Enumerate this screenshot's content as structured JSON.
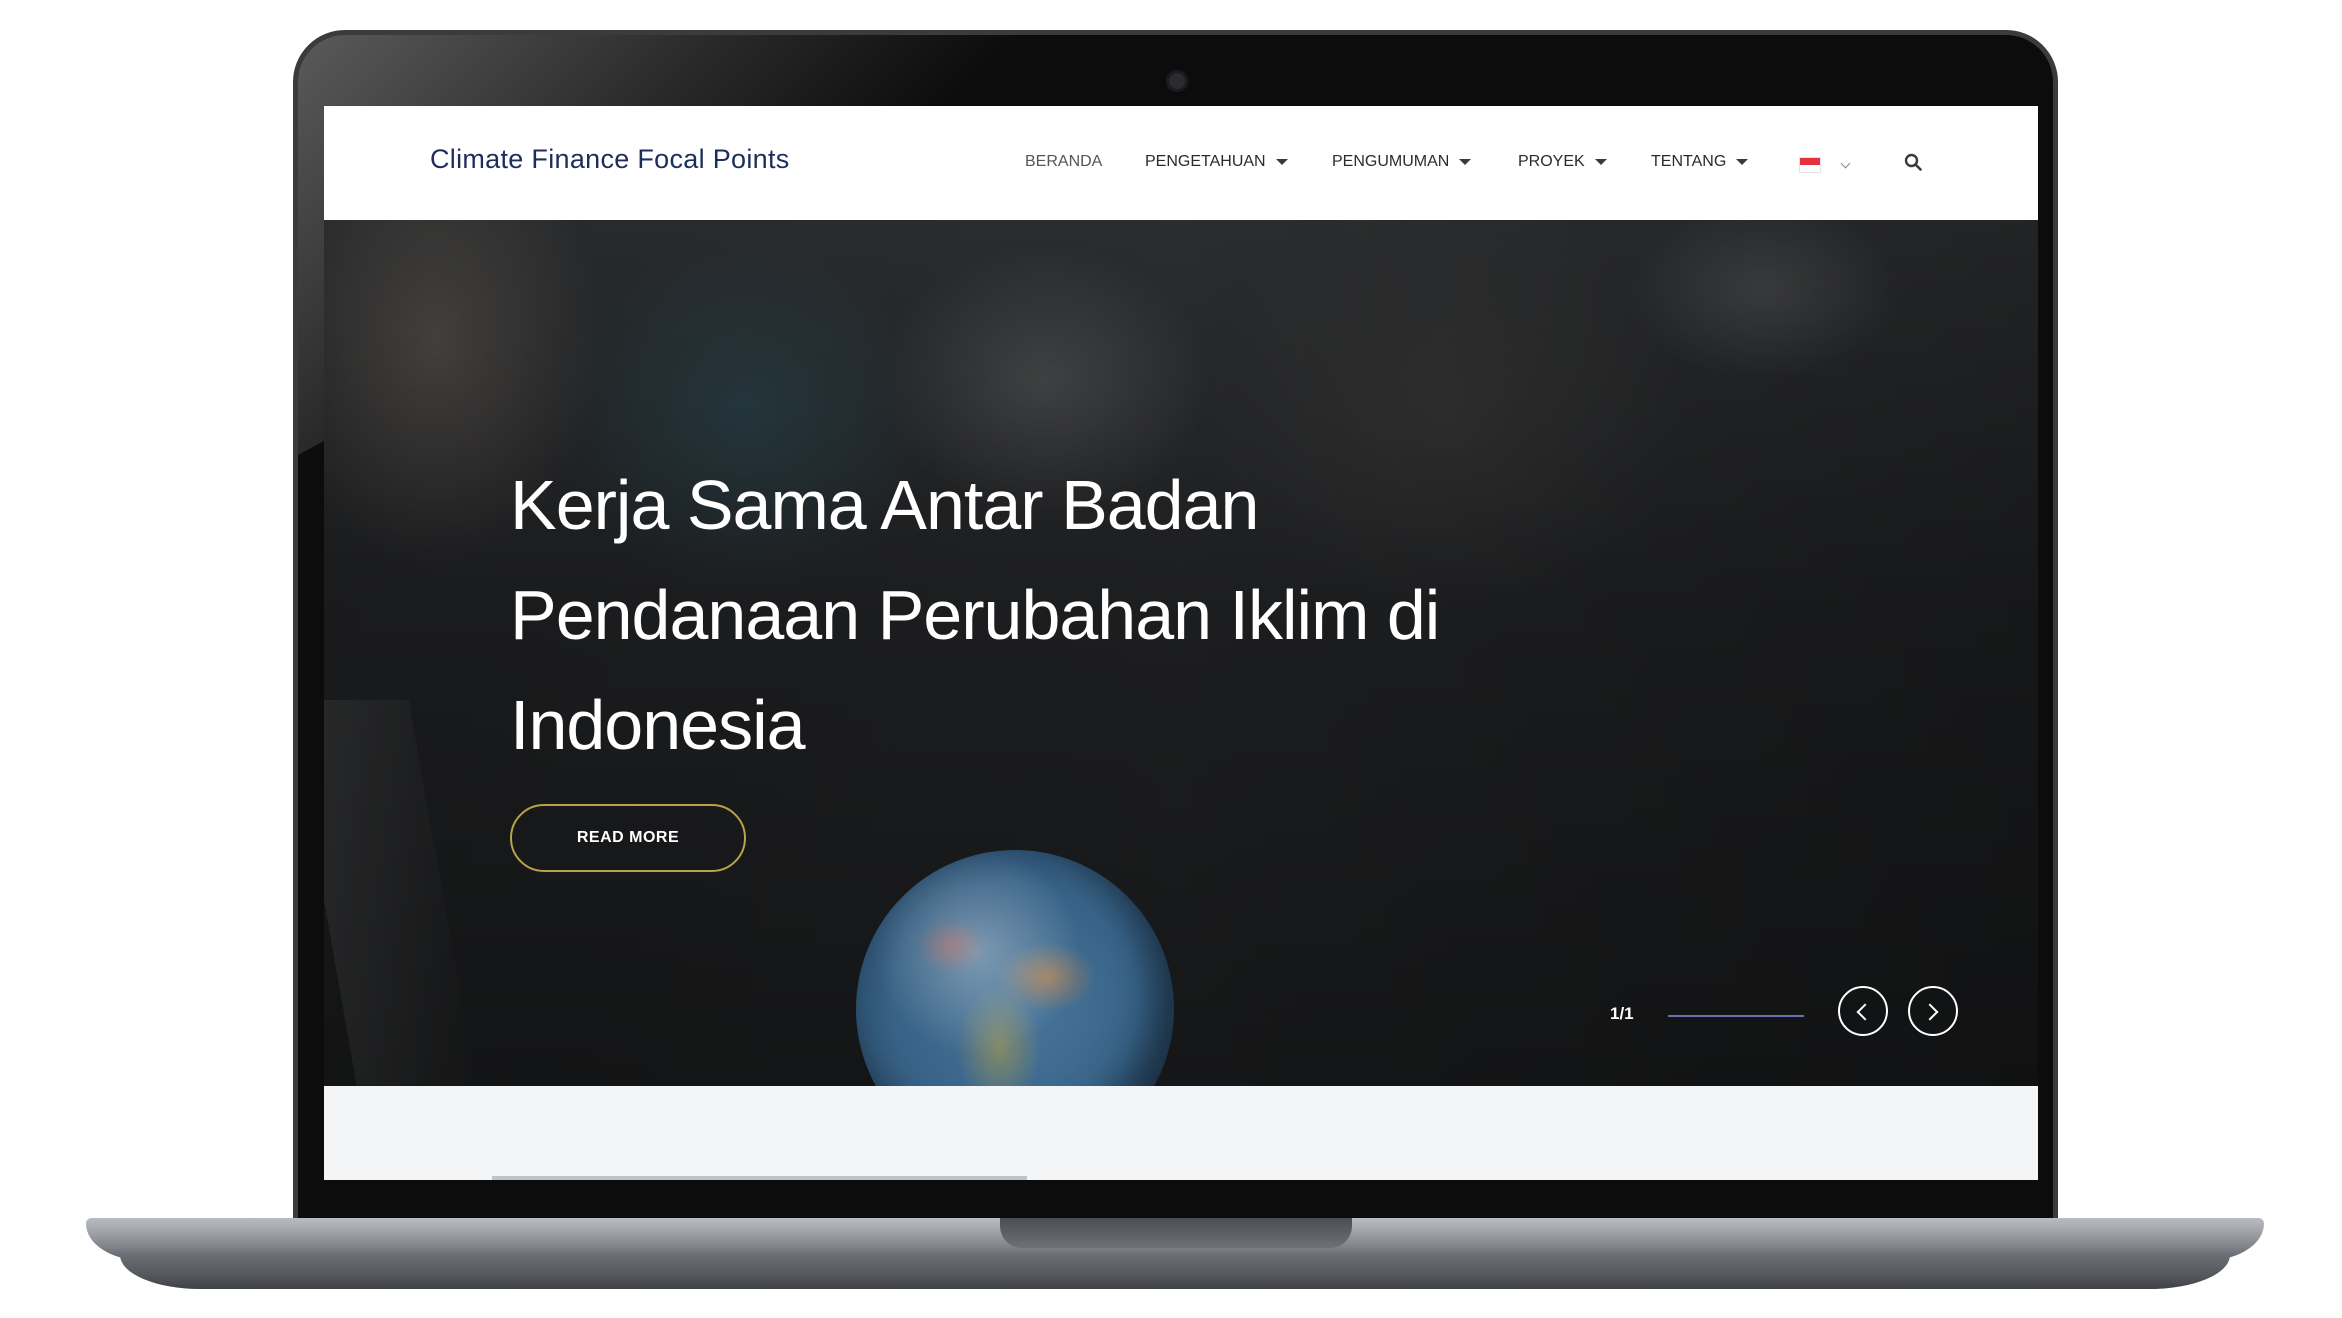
{
  "header": {
    "brand": "Climate Finance Focal Points",
    "nav": [
      {
        "label": "BERANDA",
        "has_dropdown": false
      },
      {
        "label": "PENGETAHUAN",
        "has_dropdown": true
      },
      {
        "label": "PENGUMUMAN",
        "has_dropdown": true
      },
      {
        "label": "PROYEK",
        "has_dropdown": true
      },
      {
        "label": "TENTANG",
        "has_dropdown": true
      }
    ],
    "language": {
      "icon": "indonesia-flag-icon",
      "dropdown_icon": "chevron-down-icon"
    },
    "search_icon": "search-icon"
  },
  "hero": {
    "title_line_1": "Kerja Sama Antar Badan",
    "title_line_2": "Pendanaan Perubahan Iklim di",
    "title_line_3": "Indonesia",
    "cta_label": "READ MORE",
    "slide_counter": "1/1",
    "slide_progress": 1.0,
    "prev_icon": "chevron-left-icon",
    "next_icon": "chevron-right-icon"
  },
  "colors": {
    "brand_text": "#1d2e5c",
    "cta_border": "#b8a24a",
    "progress_bar": "#3b3f6a",
    "section_bg": "#f4f5f7"
  }
}
